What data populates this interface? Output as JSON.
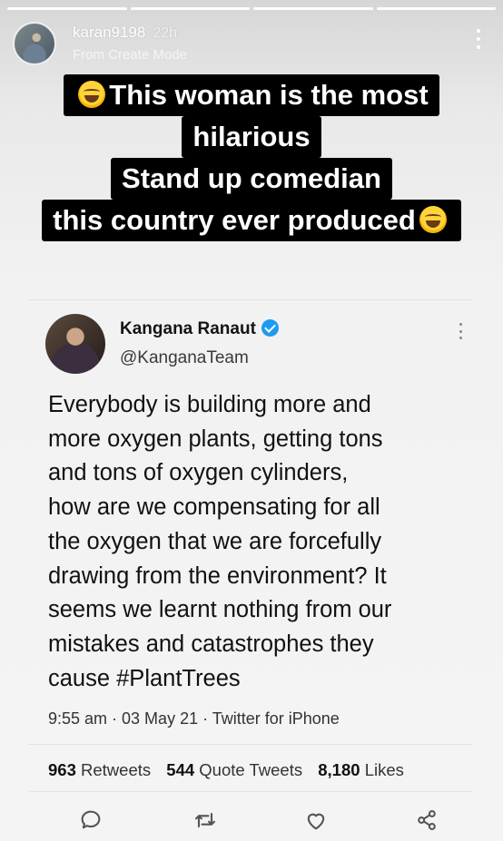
{
  "story": {
    "username": "karan9198",
    "time": "22h",
    "subtitle": "From Create Mode",
    "caption": {
      "line1": "This woman is the most",
      "line2": "hilarious",
      "line3": "Stand up comedian",
      "line4": "this country ever produced"
    }
  },
  "tweet": {
    "name": "Kangana Ranaut",
    "handle": "@KanganaTeam",
    "body_lines": [
      "Everybody is building more and",
      "more oxygen plants, getting tons",
      "and tons of oxygen cylinders,",
      "how are we compensating for all",
      "the oxygen that we are forcefully",
      "drawing from the environment? It",
      "seems we learnt nothing from our",
      "mistakes and catastrophes they",
      "cause #PlantTrees"
    ],
    "meta": "9:55 am · 03 May 21 · Twitter for iPhone",
    "stats": {
      "retweets_count": "963",
      "retweets_label": "Retweets",
      "quotes_count": "544",
      "quotes_label": "Quote Tweets",
      "likes_count": "8,180",
      "likes_label": "Likes"
    },
    "actions": [
      "reply-icon",
      "retweet-icon",
      "like-icon",
      "share-icon"
    ]
  },
  "colors": {
    "verified": "#1d9bf0",
    "caption_bg": "#000000",
    "caption_text": "#ffffff"
  }
}
